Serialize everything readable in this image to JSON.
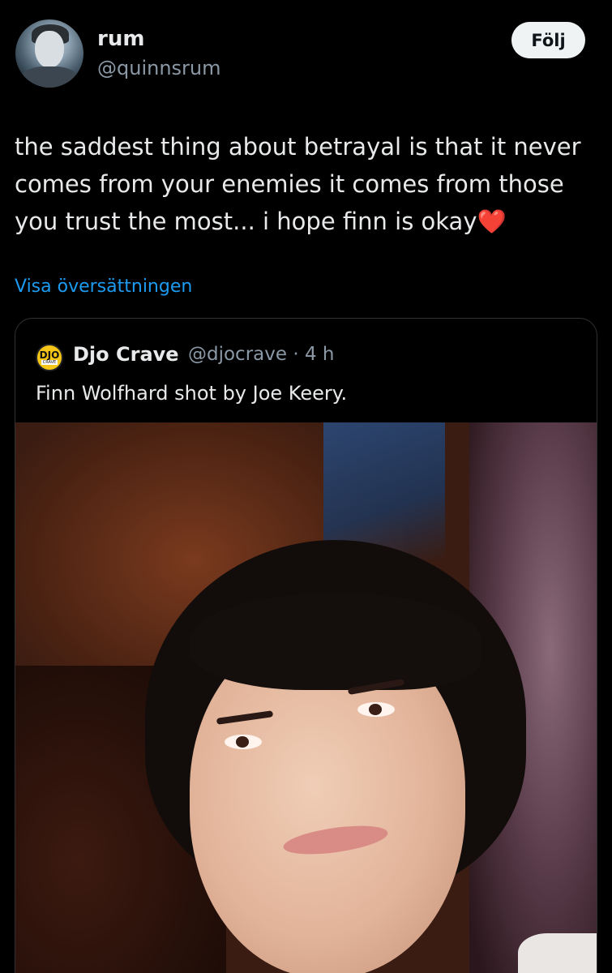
{
  "post": {
    "author": {
      "display_name": "rum",
      "handle": "@quinnsrum"
    },
    "follow_label": "Följ",
    "text": "the saddest thing about betrayal is that it never comes from your enemies it comes from those you trust the most... i hope finn is okay",
    "emoji": "❤️",
    "translate_label": "Visa översättningen"
  },
  "quote": {
    "avatar_text": {
      "top": "DJO",
      "bottom": "CRAVE"
    },
    "display_name": "Djo Crave",
    "meta": "@djocrave · 4 h",
    "text": "Finn Wolfhard shot by Joe Keery."
  },
  "colors": {
    "background": "#000000",
    "text_primary": "#e7e9ea",
    "text_secondary": "#8b98a5",
    "link": "#1d9bf0",
    "follow_bg": "#eff3f4",
    "border": "#2f3336",
    "heart": "#e0245e"
  }
}
